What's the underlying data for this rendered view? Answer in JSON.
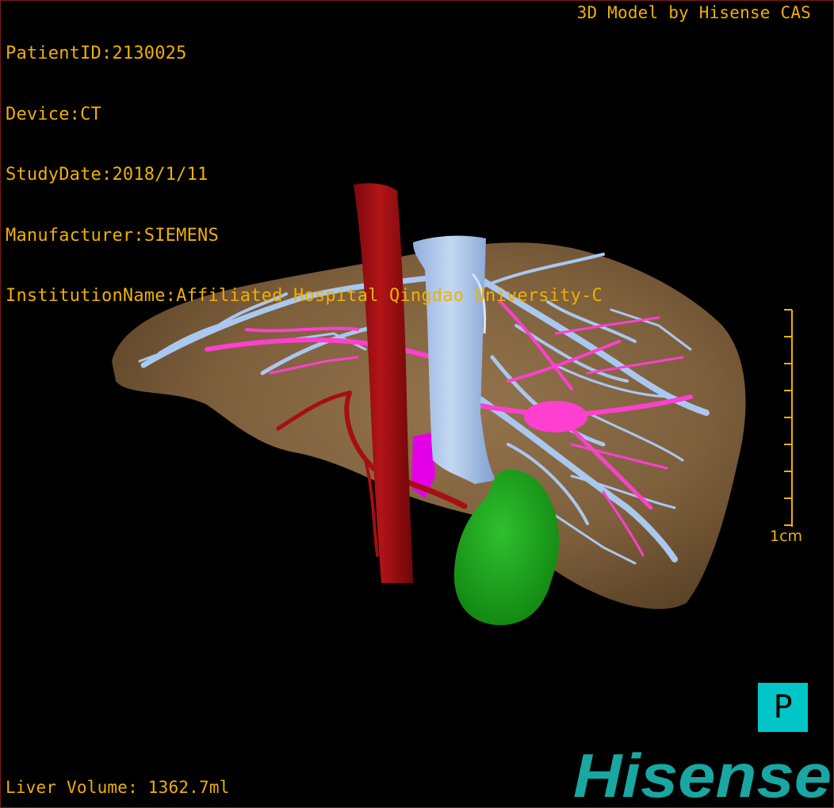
{
  "header": {
    "patient_id": "PatientID:2130025",
    "device": "Device:CT",
    "study_date": "StudyDate:2018/1/11",
    "manufacturer": "Manufacturer:SIEMENS",
    "institution": "InstitutionName:Affiliated Hospital Qingdao University-C",
    "credit": "3D Model by Hisense CAS"
  },
  "footer": {
    "liver_volume": "Liver Volume: 1362.7ml"
  },
  "scale": {
    "label": "1cm"
  },
  "orientation": {
    "label": "P"
  },
  "logo": {
    "text": "Hisense"
  },
  "colors": {
    "overlay_text": "#f0b000",
    "liver": "#8a6a45",
    "hepatic_vein": "#a9c8ef",
    "portal_vein": "#ff3fd0",
    "artery": "#a50f12",
    "gallbladder": "#1aa81a",
    "orientation_box": "#00c6c8",
    "logo": "#18a7a2"
  }
}
